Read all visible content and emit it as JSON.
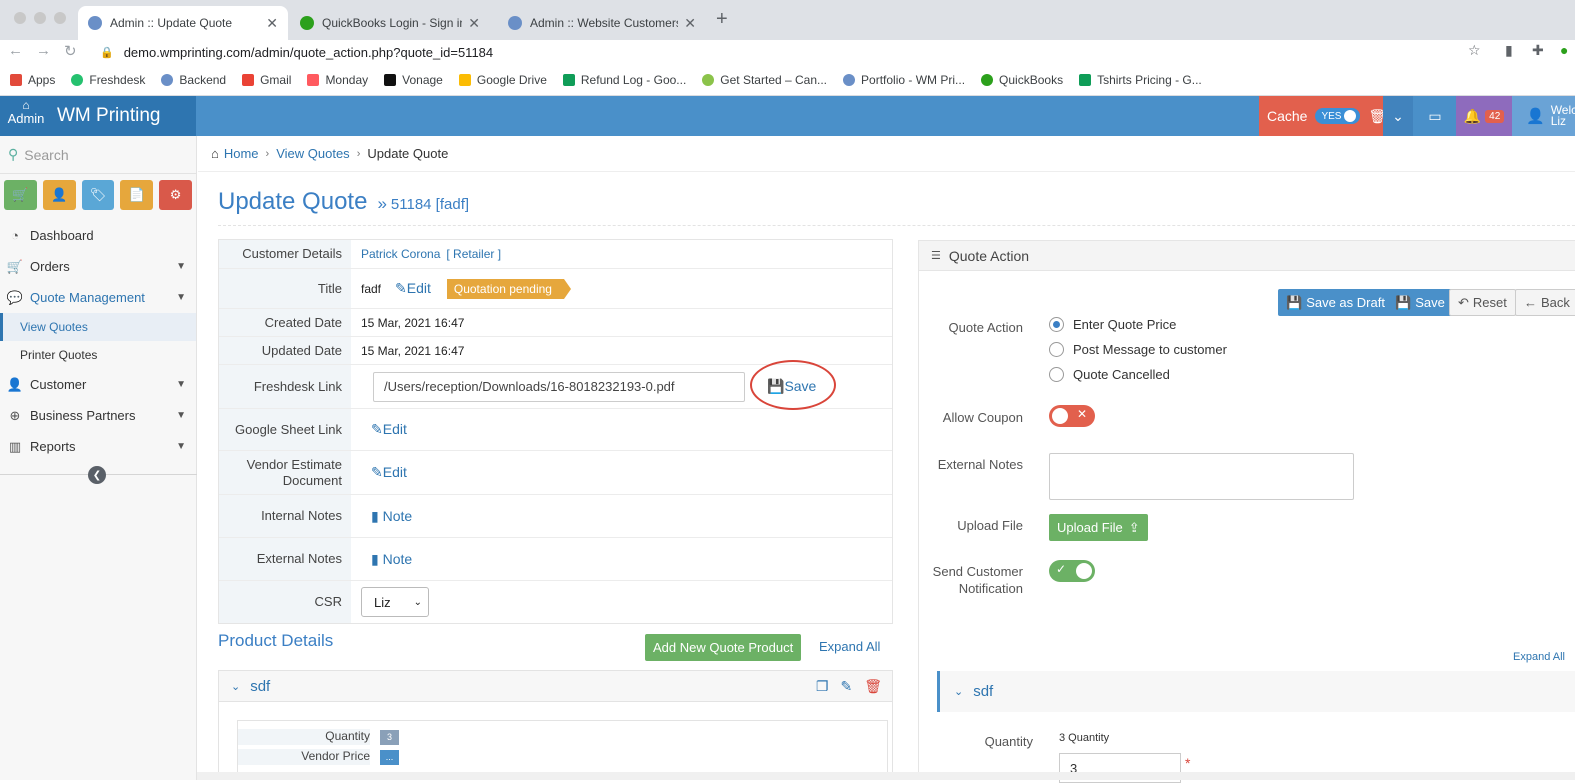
{
  "browser": {
    "tabs": [
      {
        "title": "Admin :: Update Quote",
        "active": true
      },
      {
        "title": "QuickBooks Login - Sign in to (",
        "active": false
      },
      {
        "title": "Admin :: Website Customers",
        "active": false
      }
    ],
    "url": "demo.wmprinting.com/admin/quote_action.php?quote_id=51184",
    "bookmarks": [
      "Apps",
      "Freshdesk",
      "Backend",
      "Gmail",
      "Monday",
      "Vonage",
      "Google Drive",
      "Refund Log - Goo...",
      "Get Started – Can...",
      "Portfolio - WM Pri...",
      "QuickBooks",
      "Tshirts Pricing - G..."
    ]
  },
  "header": {
    "admin_label": "Admin",
    "app_name": "WM Printing",
    "cache_label": "Cache",
    "cache_toggle": "YES",
    "notif_count": "42",
    "welcome": "Welco",
    "user": "Liz"
  },
  "sidebar": {
    "search_placeholder": "Search",
    "quick_colors": [
      "#6cb165",
      "#e6a73c",
      "#5aa7d6",
      "#e6a73c",
      "#d9594a"
    ],
    "items": [
      {
        "label": "Dashboard"
      },
      {
        "label": "Orders"
      },
      {
        "label": "Quote Management"
      },
      {
        "label": "View Quotes"
      },
      {
        "label": "Printer Quotes"
      },
      {
        "label": "Customer"
      },
      {
        "label": "Business Partners"
      },
      {
        "label": "Reports"
      }
    ]
  },
  "breadcrumb": {
    "home": "Home",
    "view_quotes": "View Quotes",
    "current": "Update Quote"
  },
  "page": {
    "title": "Update Quote",
    "quote_ref": "51184 [fadf]"
  },
  "details": {
    "customer_label": "Customer Details",
    "customer_name": "Patrick Corona",
    "customer_type": "[ Retailer ]",
    "title_label": "Title",
    "title_value": "fadf",
    "edit": "Edit",
    "status": "Quotation pending",
    "created_label": "Created Date",
    "created_value": "15 Mar, 2021 16:47",
    "updated_label": "Updated Date",
    "updated_value": "15 Mar, 2021 16:47",
    "freshdesk_label": "Freshdesk Link",
    "freshdesk_value": "/Users/reception/Downloads/16-8018232193-0.pdf",
    "save": "Save",
    "gsheet_label": "Google Sheet Link",
    "vendor_label": "Vendor Estimate Document",
    "internal_label": "Internal Notes",
    "external_label": "External Notes",
    "note": "Note",
    "csr_label": "CSR",
    "csr_value": "Liz"
  },
  "products": {
    "title": "Product Details",
    "add_button": "Add New Quote Product",
    "expand_all": "Expand All",
    "item_name": "sdf",
    "quantity_label": "Quantity",
    "quantity_value": "3",
    "vendor_price_label": "Vendor Price",
    "vendor_price_value": "..."
  },
  "quote_action": {
    "title": "Quote Action",
    "save_draft": "Save as Draft",
    "save": "Save",
    "reset": "Reset",
    "back": "Back",
    "action_label": "Quote Action",
    "options": [
      "Enter Quote Price",
      "Post Message to customer",
      "Quote Cancelled"
    ],
    "selected_option": "Enter Quote Price",
    "coupon_label": "Allow Coupon",
    "coupon_enabled": false,
    "ext_notes_label": "External Notes",
    "upload_label": "Upload File",
    "upload_button": "Upload File",
    "notify_label": "Send Customer Notification",
    "notify_enabled": true,
    "expand_all": "Expand All",
    "item_name": "sdf",
    "quantity_label": "Quantity",
    "quantity_hint": "3 Quantity",
    "quantity_value": "3",
    "required_mark": "*"
  }
}
